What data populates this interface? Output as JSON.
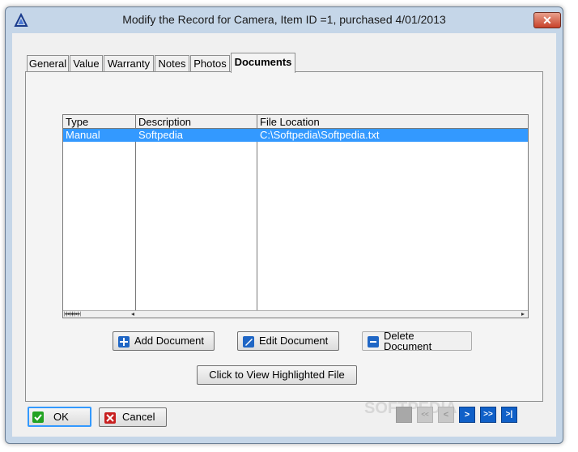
{
  "window": {
    "title": "Modify the Record for Camera, Item ID =1, purchased 4/01/2013",
    "close_symbol": "✕",
    "app_icon": "triangle-logo-icon"
  },
  "tabs": [
    {
      "label": "General",
      "active": false
    },
    {
      "label": "Value",
      "active": false
    },
    {
      "label": "Warranty",
      "active": false
    },
    {
      "label": "Notes",
      "active": false
    },
    {
      "label": "Photos",
      "active": false
    },
    {
      "label": "Documents",
      "active": true
    }
  ],
  "documents_grid": {
    "columns": [
      "Type",
      "Description",
      "File Location"
    ],
    "rows": [
      {
        "type": "Manual",
        "description": "Softpedia",
        "file_location": "C:\\Softpedia\\Softpedia.txt",
        "selected": true
      }
    ],
    "nav_glyphs": "|◂|◂◂|◂|▸|▸▸|▸|",
    "scroll_left": "◂",
    "scroll_right": "▸"
  },
  "buttons": {
    "add_document": "Add Document",
    "edit_document": "Edit Document",
    "delete_document": "Delete Document",
    "view_file": "Click to View Highlighted File",
    "ok": "OK",
    "cancel": "Cancel"
  },
  "record_nav": {
    "first": "<<",
    "prev": "<",
    "next": ">",
    "next_page": ">>",
    "last": ">|"
  },
  "watermark": "SOFTPEDIA",
  "colors": {
    "selection": "#3399ff",
    "window_frame": "#c5d6e8",
    "close_button": "#c8422a",
    "nav_enabled": "#1060c8"
  }
}
